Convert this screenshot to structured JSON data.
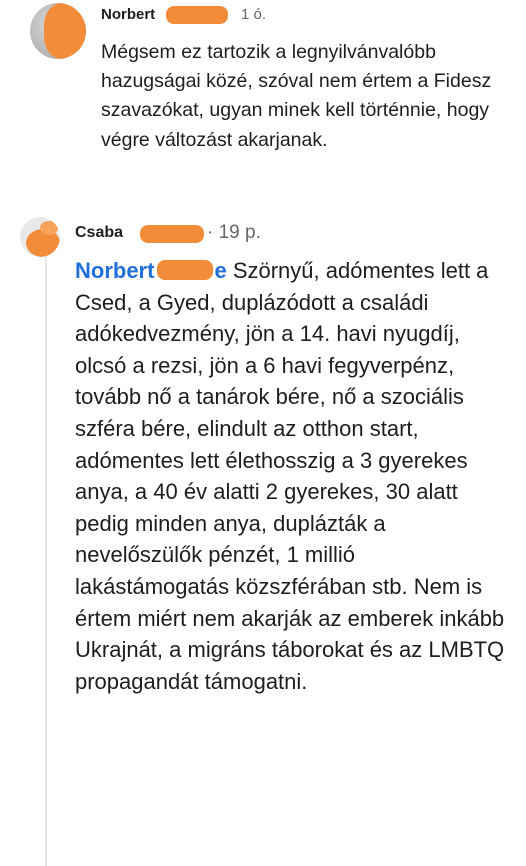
{
  "comments": [
    {
      "author": "Norbert",
      "time": "1 ó.",
      "text": "Mégsem ez tartozik a legnyilvánvalóbb hazugságai közé, szóval nem értem a Fidesz szavazókat, ugyan minek kell történnie, hogy végre változást akarjanak."
    },
    {
      "author": "Csaba",
      "time": "· 19 p.",
      "mention_first": "Norbert",
      "mention_last": "e",
      "text": " Szörnyű, adómentes lett a Csed, a Gyed, duplázódott a családi adókedvezmény, jön a 14. havi nyugdíj, olcsó a rezsi, jön a 6 havi fegyverpénz, tovább nő a tanárok bére, nő a szociális szféra bére, elindult az otthon start, adómentes lett élethosszig a 3 gyerekes anya, a 40 év alatti 2 gyerekes, 30 alatt pedig minden anya, duplázták a nevelőszülők pénzét, 1 millió lakástámogatás közszférában stb. Nem is értem miért nem akarják az emberek inkább Ukrajnát, a migráns táborokat és az LMBTQ propagandát támogatni."
    }
  ],
  "colors": {
    "mention": "#216fdb",
    "redaction": "#f28c38",
    "meta_text": "#65676b",
    "body_text": "#1c1e21"
  }
}
